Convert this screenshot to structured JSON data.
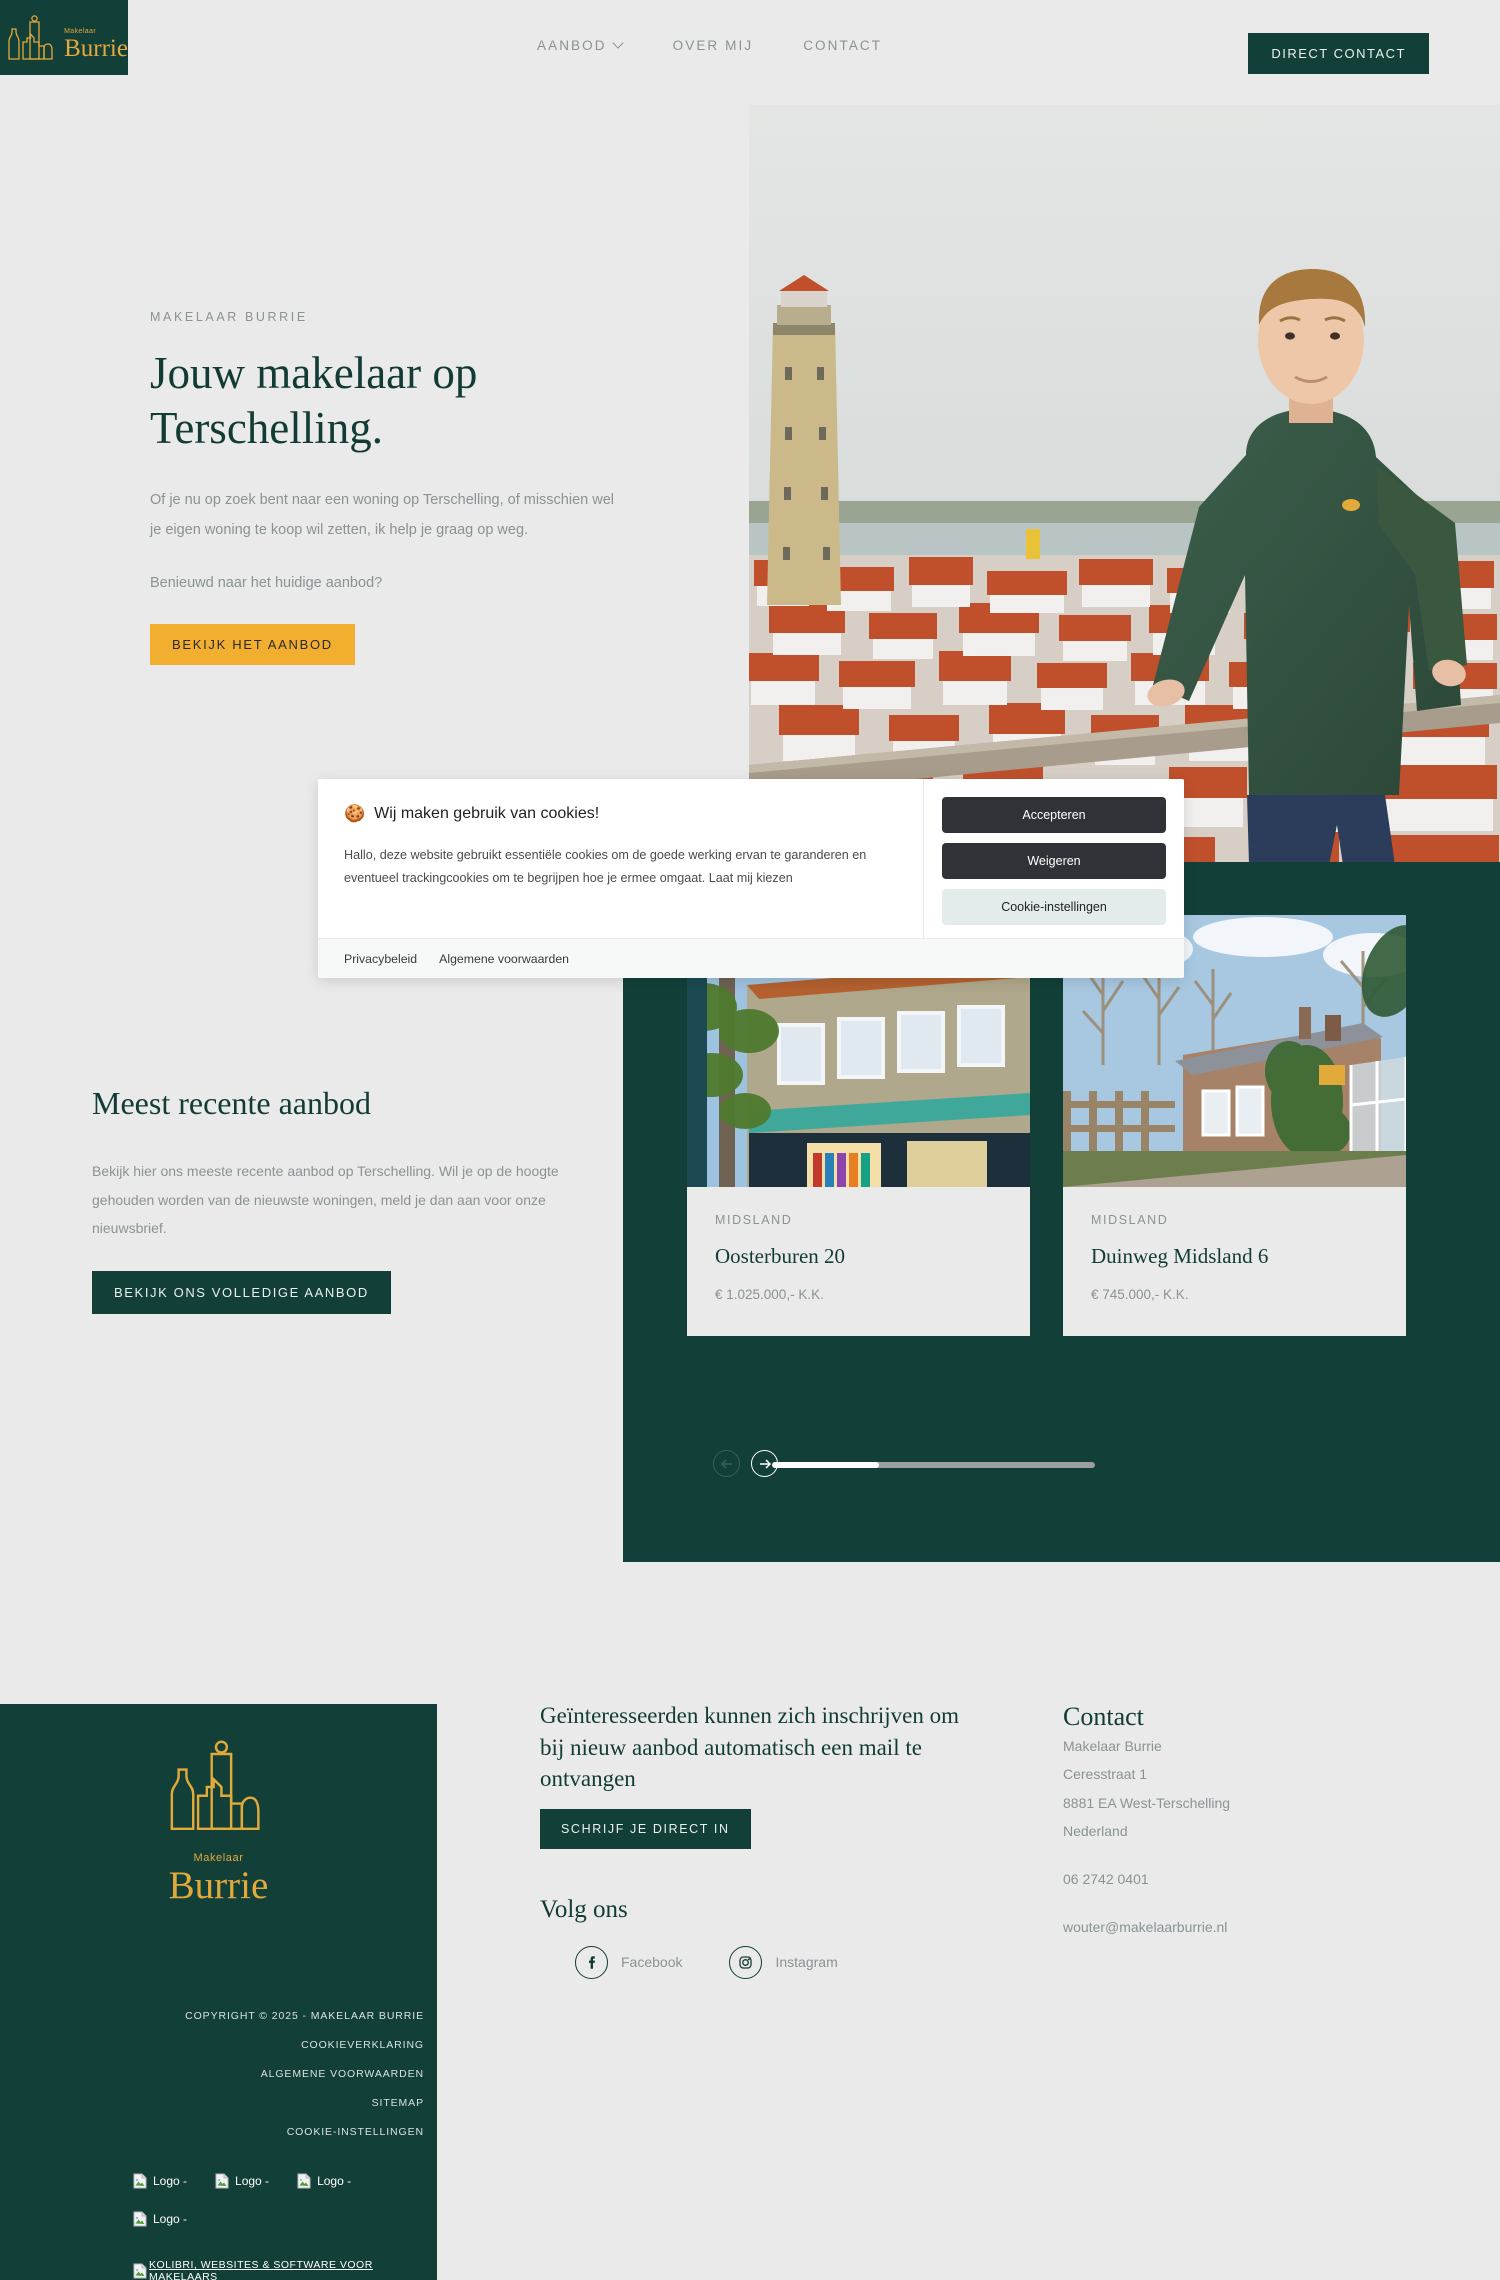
{
  "brand": {
    "sub": "Makelaar",
    "name": "Burrie",
    "gold": "#E2A93B",
    "teal": "#133F39",
    "amber": "#F2AE2E",
    "page_bg": "#EAEAEA"
  },
  "header": {
    "nav": [
      {
        "label": "Aanbod",
        "has_dropdown": true
      },
      {
        "label": "Over mij",
        "has_dropdown": false
      },
      {
        "label": "Contact",
        "has_dropdown": false
      }
    ],
    "cta": "Direct contact"
  },
  "hero": {
    "eyebrow": "Makelaar Burrie",
    "title_line1": "Jouw makelaar op",
    "title_line2": "Terschelling.",
    "paragraph": "Of je nu op zoek bent naar een woning op Terschelling, of misschien wel je eigen woning te koop wil zetten, ik help je graag op weg.",
    "question": "Benieuwd naar het huidige aanbod?",
    "button": "Bekijk het aanbod",
    "image_alt": "Makelaar staand bij hek met uitzicht op Brandaris vuurtoren en West-Terschelling"
  },
  "recent": {
    "heading": "Meest recente aanbod",
    "paragraph": "Bekijk hier ons meeste recente aanbod op Terschelling. Wil je op de hoogte gehouden worden van de nieuwste woningen, meld je dan aan voor onze nieuwsbrief.",
    "button": "Bekijk ons volledige aanbod"
  },
  "listings": [
    {
      "city": "Midsland",
      "title": "Oosterburen 20",
      "price": "€ 1.025.000,- K.K.",
      "image_alt": "Winkelpand met luifel en kledingrek onder een boom"
    },
    {
      "city": "Midsland",
      "title": "Duinweg Midsland 6",
      "price": "€ 745.000,- K.K.",
      "image_alt": "Vrijstaande bungalow met klimop en grind oprit"
    }
  ],
  "carousel": {
    "prev_label": "Vorige",
    "next_label": "Volgende",
    "progress_percent": 33
  },
  "cookie": {
    "icon": "cookie-emoji",
    "title": "Wij maken gebruik van cookies!",
    "body": "Hallo, deze website gebruikt essentiële cookies om de goede werking ervan te garanderen en eventueel trackingcookies om te begrijpen hoe je ermee omgaat. Laat mij kiezen",
    "accept": "Accepteren",
    "decline": "Weigeren",
    "settings": "Cookie-instellingen",
    "link_privacy": "Privacybeleid",
    "link_terms": "Algemene voorwaarden"
  },
  "footer": {
    "newsletter_heading": "Geïnteresseerden kunnen zich inschrijven om bij nieuw aanbod automatisch een mail te ontvangen",
    "newsletter_button": "Schrijf je direct in",
    "follow_heading": "Volg ons",
    "socials": [
      {
        "label": "Facebook",
        "icon": "facebook-icon"
      },
      {
        "label": "Instagram",
        "icon": "instagram-icon"
      }
    ],
    "contact_heading": "Contact",
    "contact_lines": [
      "Makelaar Burrie",
      "Ceresstraat 1",
      "8881 EA West-Terschelling",
      "Nederland"
    ],
    "phone": "06 2742 0401",
    "email": "wouter@makelaarburrie.nl",
    "copyright": "Copyright © 2025 - Makelaar Burrie",
    "links": [
      "Cookieverklaring",
      "Algemene voorwaarden",
      "Sitemap",
      "Cookie-instellingen"
    ],
    "broken_logos": [
      "Logo -",
      "Logo -",
      "Logo -",
      "Logo -"
    ],
    "kolibri": "Kolibri, websites & software voor makelaars"
  }
}
